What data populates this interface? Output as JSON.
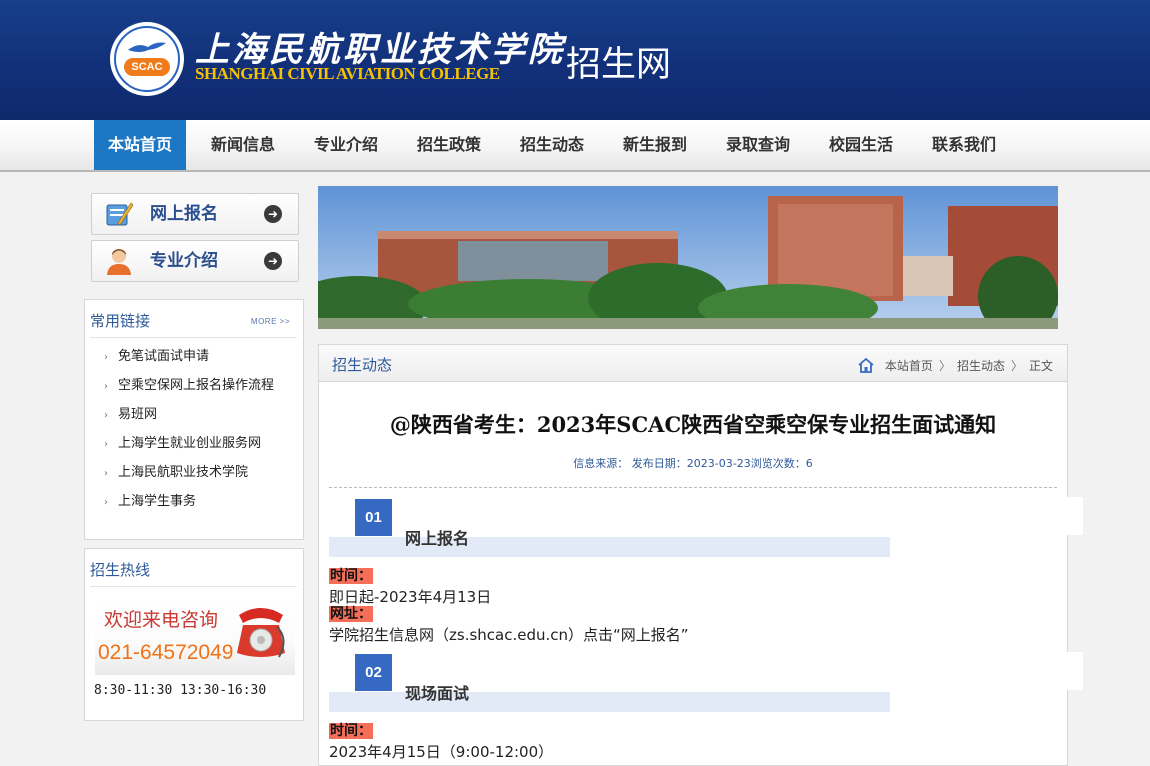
{
  "header": {
    "cn_name": "上海民航职业技术学院",
    "en_name": "SHANGHAI CIVIL AVIATION COLLEGE",
    "site_name": "招生网",
    "logo_abbr": "SCAC",
    "brand_blue": "#12307a",
    "brand_gold": "#f5c100"
  },
  "nav": {
    "items": [
      "本站首页",
      "新闻信息",
      "专业介绍",
      "招生政策",
      "招生动态",
      "新生报到",
      "录取查询",
      "校园生活",
      "联系我们"
    ],
    "active_index": 0,
    "active_color": "#1c78c4"
  },
  "sidebar": {
    "buttons": [
      {
        "label": "网上报名",
        "icon": "pen-form-icon"
      },
      {
        "label": "专业介绍",
        "icon": "user-icon"
      }
    ],
    "links_box": {
      "title": "常用链接",
      "more": "MORE >>",
      "items": [
        "免笔试面试申请",
        "空乘空保网上报名操作流程",
        "易班网",
        "上海学生就业创业服务网",
        "上海民航职业技术学院",
        "上海学生事务"
      ]
    },
    "hotline_box": {
      "title": "招生热线",
      "welcome": "欢迎来电咨询",
      "phone": "021-64572049",
      "hours": "8:30-11:30 13:30-16:30"
    }
  },
  "panel": {
    "title": "招生动态",
    "breadcrumb": [
      "本站首页",
      "招生动态",
      "正文"
    ],
    "article": {
      "title": "@陕西省考生：2023年SCAC陕西省空乘空保专业招生面试通知",
      "meta": "信息来源：  发布日期：2023-03-23浏览次数：6",
      "sections": [
        {
          "num": "01",
          "name": "网上报名",
          "time_label": "时间：",
          "time_value": "即日起-2023年4月13日",
          "addr_label": "网址：",
          "addr_value": "学院招生信息网（zs.shcac.edu.cn）点击“网上报名”"
        },
        {
          "num": "02",
          "name": "现场面试",
          "time_label": "时间：",
          "time_value": "2023年4月15日（9:00-12:00）"
        }
      ]
    }
  }
}
